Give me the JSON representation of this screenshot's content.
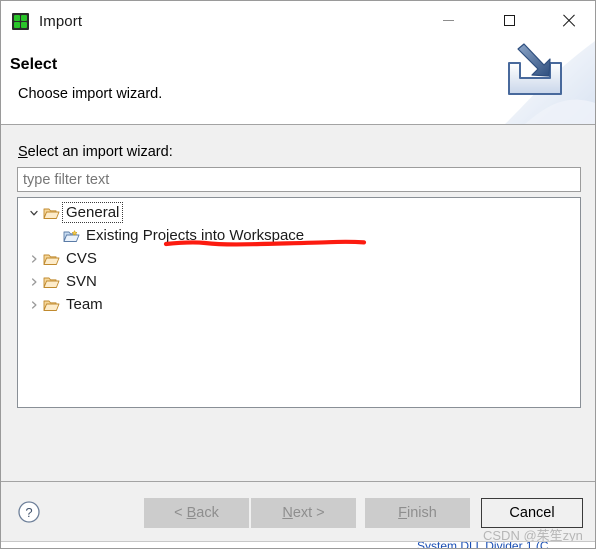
{
  "window": {
    "title": "Import",
    "app_icon": "eclipse-import-icon",
    "controls": {
      "minimize": "minimize-icon",
      "maximize": "maximize-icon",
      "close": "close-icon"
    }
  },
  "header": {
    "title": "Select",
    "subtitle": "Choose import wizard.",
    "banner_icon": "import-tray-arrow-icon"
  },
  "body": {
    "tree_label": "Select an import wizard:",
    "tree_label_mnemonic": "S",
    "tree_label_rest": "elect an import wizard:",
    "filter": {
      "value": "",
      "placeholder": "type filter text"
    },
    "tree": [
      {
        "label": "General",
        "level": 0,
        "expanded": true,
        "focused": true,
        "icon": "folder-open-icon"
      },
      {
        "label": "Existing Projects into Workspace",
        "level": 1,
        "expanded": null,
        "focused": false,
        "icon": "wizard-folder-icon"
      },
      {
        "label": "CVS",
        "level": 0,
        "expanded": false,
        "focused": false,
        "icon": "folder-open-icon"
      },
      {
        "label": "SVN",
        "level": 0,
        "expanded": false,
        "focused": false,
        "icon": "folder-open-icon"
      },
      {
        "label": "Team",
        "level": 0,
        "expanded": false,
        "focused": false,
        "icon": "folder-open-icon"
      }
    ],
    "annotation": {
      "type": "red-underline",
      "color": "#fc1b10",
      "target": "Existing Projects into Workspace"
    }
  },
  "footer": {
    "help_icon": "help-question-icon",
    "buttons": [
      {
        "name": "back",
        "label": "< Back",
        "mnemonic": "B",
        "enabled": false,
        "default": false
      },
      {
        "name": "next",
        "label": "Next >",
        "mnemonic": "N",
        "enabled": false,
        "default": false
      },
      {
        "name": "finish",
        "label": "Finish",
        "mnemonic": "F",
        "enabled": false,
        "default": false
      },
      {
        "name": "cancel",
        "label": "Cancel",
        "mnemonic": "",
        "enabled": true,
        "default": true
      }
    ]
  },
  "watermark": "CSDN @茱笙zyn",
  "background_strip_text": "System DLL Divider 1 (C",
  "colors": {
    "dialog_bg": "#f0f0f0",
    "header_bg": "#ffffff",
    "field_bg": "#ffffff",
    "border": "#9c9c9c",
    "disabled_button": "#cccccc",
    "annotation_red": "#fc1b10",
    "app_icon_green": "#2ac52a"
  }
}
